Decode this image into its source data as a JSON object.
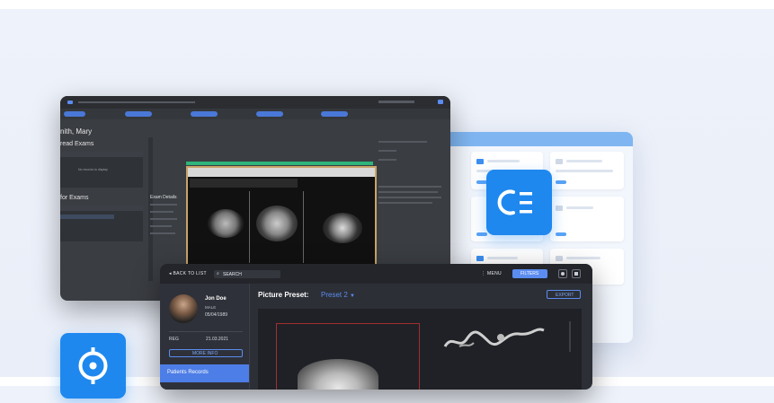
{
  "front": {
    "back_label": "BACK TO LIST",
    "search_label": "SEARCH",
    "menu_label": "MENU",
    "filters_label": "FILTERS",
    "patient_name": "Jon Doe",
    "patient_sex": "MALE",
    "patient_dob": "05/04/1989",
    "reg_label": "REG",
    "reg_date": "21.03.2021",
    "more_info_label": "MORE INFO",
    "records_label": "Patients Records",
    "preset_label": "Picture Preset:",
    "preset_value": "Preset 2",
    "export_label": "EXPORT"
  },
  "dark": {
    "patient_title": "nith, Mary",
    "prior_heading": "read Exams",
    "for_exams_heading": "for Exams",
    "exam_details_heading": "Exam Details",
    "no_records_text": "No records to display"
  },
  "colors": {
    "accent": "#1e88ef",
    "filter_button": "#5b8cf0",
    "preset_text": "#5b8cf0"
  },
  "icons": {
    "ce_tile": "ce-logo-icon",
    "target_tile": "crosshair-icon"
  }
}
